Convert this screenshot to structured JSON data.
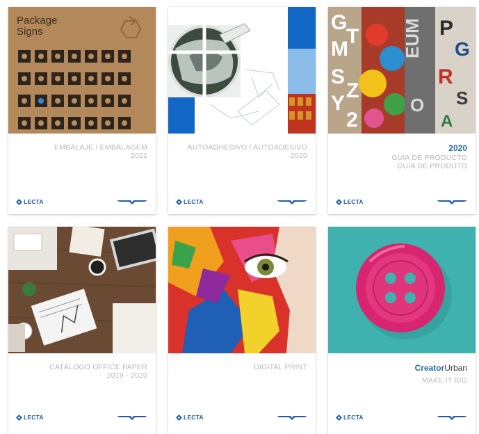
{
  "catalogs": [
    {
      "lines": [
        "EMBALAJE / EMBALAGEM",
        "2021"
      ],
      "cover_text": [
        "Package",
        "Signs"
      ],
      "logo": "LECTA"
    },
    {
      "lines": [
        "AUTOADHESIVO / AUTOADESIVO",
        "2020"
      ],
      "logo": "LECTA"
    },
    {
      "year": "2020",
      "lines": [
        "GUÍA DE PRODUCTO",
        "GUIA DE PRODUTO"
      ],
      "logo": "LECTA"
    },
    {
      "lines": [
        "CATÁLOGO OFFICE PAPER",
        "2019 - 2020"
      ],
      "logo": "LECTA"
    },
    {
      "lines": [
        "DIGITAL PRINT"
      ],
      "logo": "LECTA"
    },
    {
      "brand_bold": "Creator",
      "brand_rest": "Urban",
      "lines": [
        "MAKE IT BIG"
      ],
      "logo": "LECTA"
    }
  ],
  "colors": {
    "brand_blue": "#2a6ab3",
    "caption_gray": "#b8b8b8",
    "kraft": "#b58a5c"
  },
  "icons": [
    "lecta-logo-icon",
    "wings-logo-icon"
  ]
}
